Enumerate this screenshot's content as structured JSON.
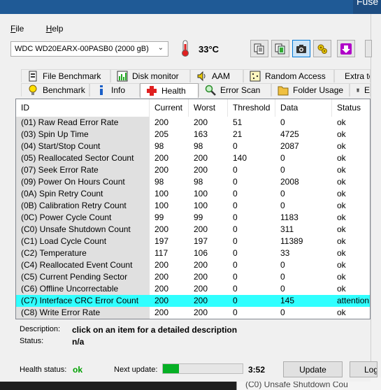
{
  "background": {
    "title_fragment": "Fuse",
    "bottom_panel_text": "(C0) Unsafe Shutdown Cou"
  },
  "menu": [
    {
      "label": "ile",
      "mnemonic": "F"
    },
    {
      "label": "elp",
      "mnemonic": "H"
    }
  ],
  "drive": {
    "selected": "WDC WD20EARX-00PASB0 (2000 gB)",
    "temperature": "33°C"
  },
  "toolbar": {
    "buttons": [
      "copy-text-icon",
      "copy-info-icon",
      "screenshot-icon",
      "options-icon",
      "download-icon",
      "exit-icon"
    ]
  },
  "tabs": {
    "row1": [
      "File Benchmark",
      "Disk monitor",
      "AAM",
      "Random Access",
      "Extra te"
    ],
    "row2": [
      "Benchmark",
      "Info",
      "Health",
      "Error Scan",
      "Folder Usage",
      "E"
    ]
  },
  "table": {
    "columns": [
      "ID",
      "Current",
      "Worst",
      "Threshold",
      "Data",
      "Status"
    ],
    "rows": [
      {
        "id": "(01) Raw Read Error Rate",
        "current": "200",
        "worst": "200",
        "threshold": "51",
        "data": "0",
        "status": "ok"
      },
      {
        "id": "(03) Spin Up Time",
        "current": "205",
        "worst": "163",
        "threshold": "21",
        "data": "4725",
        "status": "ok"
      },
      {
        "id": "(04) Start/Stop Count",
        "current": "98",
        "worst": "98",
        "threshold": "0",
        "data": "2087",
        "status": "ok"
      },
      {
        "id": "(05) Reallocated Sector Count",
        "current": "200",
        "worst": "200",
        "threshold": "140",
        "data": "0",
        "status": "ok"
      },
      {
        "id": "(07) Seek Error Rate",
        "current": "200",
        "worst": "200",
        "threshold": "0",
        "data": "0",
        "status": "ok"
      },
      {
        "id": "(09) Power On Hours Count",
        "current": "98",
        "worst": "98",
        "threshold": "0",
        "data": "2008",
        "status": "ok"
      },
      {
        "id": "(0A) Spin Retry Count",
        "current": "100",
        "worst": "100",
        "threshold": "0",
        "data": "0",
        "status": "ok"
      },
      {
        "id": "(0B) Calibration Retry Count",
        "current": "100",
        "worst": "100",
        "threshold": "0",
        "data": "0",
        "status": "ok"
      },
      {
        "id": "(0C) Power Cycle Count",
        "current": "99",
        "worst": "99",
        "threshold": "0",
        "data": "1183",
        "status": "ok"
      },
      {
        "id": "(C0) Unsafe Shutdown Count",
        "current": "200",
        "worst": "200",
        "threshold": "0",
        "data": "311",
        "status": "ok"
      },
      {
        "id": "(C1) Load Cycle Count",
        "current": "197",
        "worst": "197",
        "threshold": "0",
        "data": "11389",
        "status": "ok"
      },
      {
        "id": "(C2) Temperature",
        "current": "117",
        "worst": "106",
        "threshold": "0",
        "data": "33",
        "status": "ok"
      },
      {
        "id": "(C4) Reallocated Event Count",
        "current": "200",
        "worst": "200",
        "threshold": "0",
        "data": "0",
        "status": "ok"
      },
      {
        "id": "(C5) Current Pending Sector",
        "current": "200",
        "worst": "200",
        "threshold": "0",
        "data": "0",
        "status": "ok"
      },
      {
        "id": "(C6) Offline Uncorrectable",
        "current": "200",
        "worst": "200",
        "threshold": "0",
        "data": "0",
        "status": "ok"
      },
      {
        "id": "(C7) Interface CRC Error Count",
        "current": "200",
        "worst": "200",
        "threshold": "0",
        "data": "145",
        "status": "attention"
      },
      {
        "id": "(C8) Write Error Rate",
        "current": "200",
        "worst": "200",
        "threshold": "0",
        "data": "0",
        "status": "ok"
      }
    ]
  },
  "description": {
    "label": "Description:",
    "value": "click on an item for a detailed description",
    "status_label": "Status:",
    "status_value": "n/a"
  },
  "footer": {
    "health_label": "Health status:",
    "health_value": "ok",
    "next_update_label": "Next update:",
    "progress_fraction": 0.2,
    "countdown": "3:52",
    "update_button": "Update",
    "log_button": "Log"
  },
  "colors": {
    "highlight_row": "#30ffff",
    "ok_green": "#00a000",
    "progress_green": "#06b025"
  }
}
